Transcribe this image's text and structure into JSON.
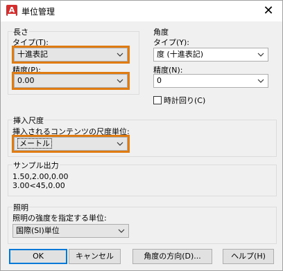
{
  "window": {
    "title": "単位管理",
    "close_glyph": "✕"
  },
  "length": {
    "group_label": "長さ",
    "type_label": "タイプ(T):",
    "type_value": "十進表記",
    "precision_label": "精度(P):",
    "precision_value": "0.00"
  },
  "angle": {
    "group_label": "角度",
    "type_label": "タイプ(Y):",
    "type_value": "度 (十進表記)",
    "precision_label": "精度(N):",
    "precision_value": "0",
    "clockwise_label": "時計回り(C)",
    "clockwise_checked": false
  },
  "insertion": {
    "group_label": "挿入尺度",
    "units_label": "挿入されるコンテンツの尺度単位:",
    "units_value": "メートル"
  },
  "sample": {
    "group_label": "サンプル出力",
    "lines": [
      "1.50,2.00,0.00",
      "3.00<45,0.00"
    ]
  },
  "lighting": {
    "group_label": "照明",
    "units_label": "照明の強度を指定する単位:",
    "units_value": "国際(SI)単位"
  },
  "buttons": {
    "ok": "OK",
    "cancel": "キャンセル",
    "direction": "角度の方向(D)...",
    "help": "ヘルプ(H)"
  },
  "colors": {
    "highlight": "#e07b12",
    "default_button_border": "#0078d7"
  }
}
